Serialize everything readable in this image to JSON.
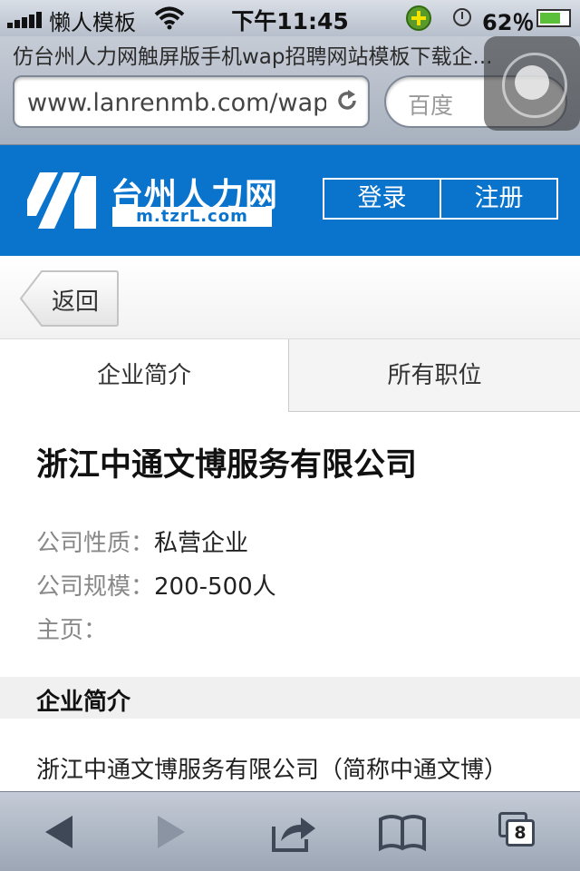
{
  "status_bar": {
    "carrier": "懒人模板",
    "time": "下午11:45",
    "battery_percent": "62％"
  },
  "browser": {
    "page_title": "仿台州人力网触屏版手机wap招聘网站模板下载企...",
    "url": "www.lanrenmb.com/wap",
    "search_placeholder": "百度"
  },
  "site": {
    "logo_name": "台州人力网",
    "logo_domain": "m.tzrL.com",
    "login_label": "登录",
    "register_label": "注册",
    "brand_color": "#0a73cc"
  },
  "nav": {
    "back_label": "返回"
  },
  "tabs": [
    {
      "label": "企业简介",
      "active": true
    },
    {
      "label": "所有职位",
      "active": false
    }
  ],
  "company": {
    "name": "浙江中通文博服务有限公司",
    "info": [
      {
        "label": "公司性质：",
        "value": "私营企业"
      },
      {
        "label": "公司规模：",
        "value": "200-500人"
      },
      {
        "label": "主页：",
        "value": ""
      }
    ],
    "section_title": "企业简介",
    "intro": "浙江中通文博服务有限公司（简称中通文博）"
  },
  "toolbar": {
    "tabs_count": "8",
    "icons": [
      "back-arrow-icon",
      "forward-arrow-icon",
      "share-icon",
      "bookmarks-icon",
      "tabs-icon"
    ]
  }
}
